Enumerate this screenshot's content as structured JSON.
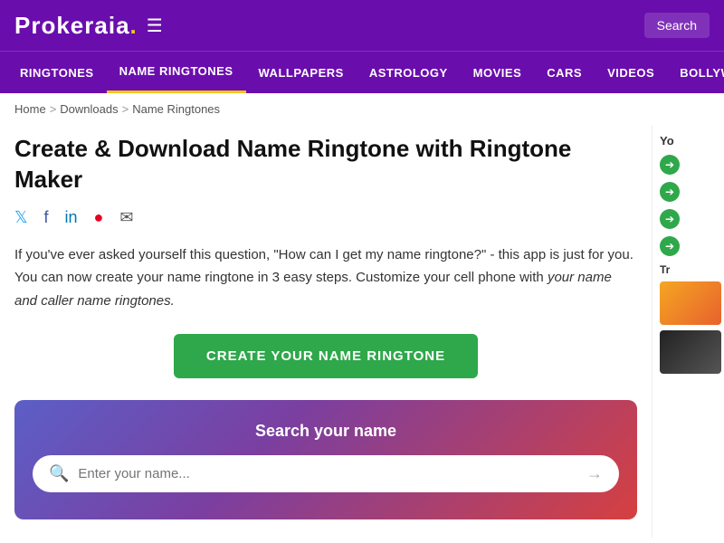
{
  "header": {
    "logo": "Prokeraia",
    "logo_dot": ".",
    "search_label": "Search"
  },
  "nav": {
    "items": [
      {
        "label": "RINGTONES",
        "active": false
      },
      {
        "label": "NAME RINGTONES",
        "active": true
      },
      {
        "label": "WALLPAPERS",
        "active": false
      },
      {
        "label": "ASTROLOGY",
        "active": false
      },
      {
        "label": "MOVIES",
        "active": false
      },
      {
        "label": "CARS",
        "active": false
      },
      {
        "label": "VIDEOS",
        "active": false
      },
      {
        "label": "BOLLYW...",
        "active": false
      }
    ]
  },
  "breadcrumb": {
    "home": "Home",
    "sep1": ">",
    "downloads": "Downloads",
    "sep2": ">",
    "current": "Name Ringtones"
  },
  "page": {
    "title": "Create & Download Name Ringtone with Ringtone Maker",
    "description_q": "\"How can I get my name ringtone?\"",
    "description_text1": "If you've ever asked yourself this question, ",
    "description_text2": " - this app is just for you. You can now create your name ringtone in 3 easy steps. Customize your cell phone with ",
    "description_italic": "your name and caller name ringtones.",
    "cta_label": "CREATE YOUR NAME RINGTONE"
  },
  "search_section": {
    "title": "Search your name",
    "input_placeholder": "Enter your name..."
  },
  "sidebar": {
    "yo_label": "Yo",
    "trending_label": "Tr"
  }
}
